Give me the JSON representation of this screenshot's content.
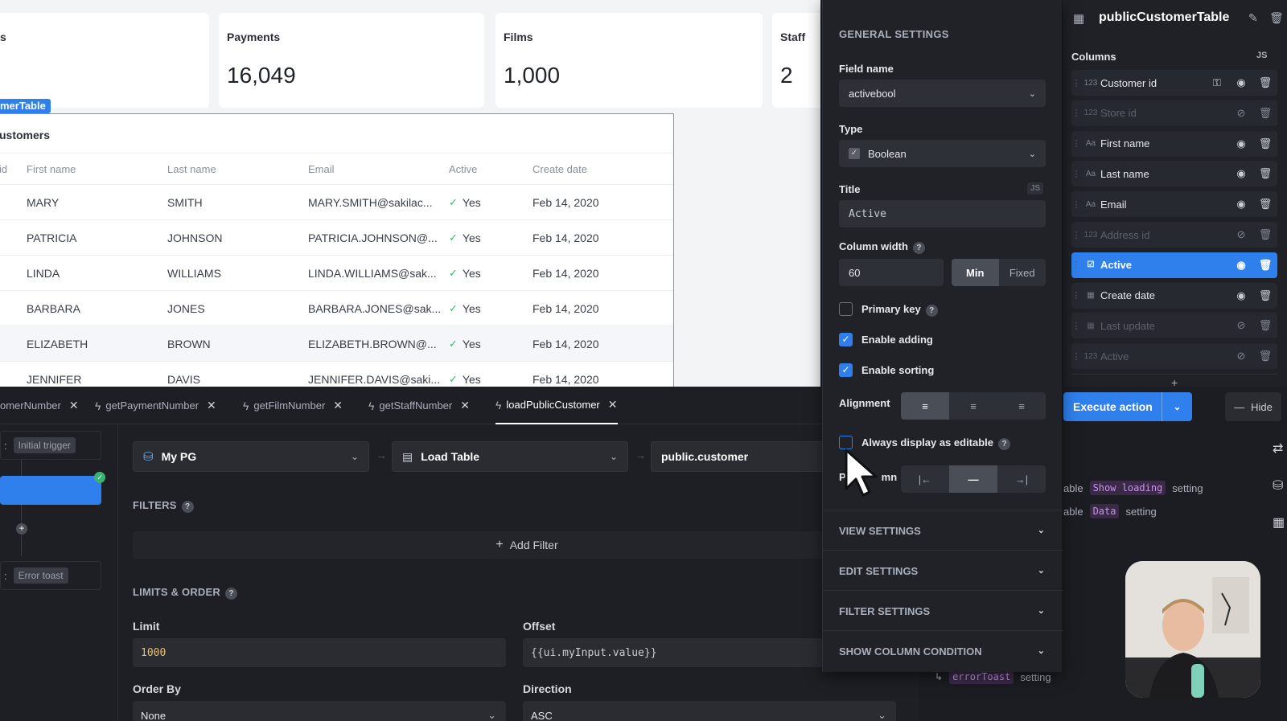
{
  "stats": [
    {
      "label": "s",
      "value": ""
    },
    {
      "label": "Payments",
      "value": "16,049"
    },
    {
      "label": "Films",
      "value": "1,000"
    },
    {
      "label": "Staff",
      "value": "2"
    }
  ],
  "table": {
    "tag": "merTable",
    "heading": "ustomers",
    "columns": [
      "id",
      "First name",
      "Last name",
      "Email",
      "Active",
      "Create date"
    ],
    "rows": [
      [
        "MARY",
        "SMITH",
        "MARY.SMITH@sakilac...",
        "Yes",
        "Feb 14, 2020"
      ],
      [
        "PATRICIA",
        "JOHNSON",
        "PATRICIA.JOHNSON@...",
        "Yes",
        "Feb 14, 2020"
      ],
      [
        "LINDA",
        "WILLIAMS",
        "LINDA.WILLIAMS@sak...",
        "Yes",
        "Feb 14, 2020"
      ],
      [
        "BARBARA",
        "JONES",
        "BARBARA.JONES@sak...",
        "Yes",
        "Feb 14, 2020"
      ],
      [
        "ELIZABETH",
        "BROWN",
        "ELIZABETH.BROWN@...",
        "Yes",
        "Feb 14, 2020"
      ],
      [
        "JENNIFER",
        "DAVIS",
        "JENNIFER.DAVIS@saki...",
        "Yes",
        "Feb 14, 2020"
      ]
    ]
  },
  "query_tabs": [
    {
      "label": "omerNumber",
      "active": false
    },
    {
      "label": "getPaymentNumber",
      "active": false
    },
    {
      "label": "getFilmNumber",
      "active": false
    },
    {
      "label": "getStaffNumber",
      "active": false
    },
    {
      "label": "loadPublicCustomer",
      "active": true
    }
  ],
  "flow": {
    "trigger_prefix": ":",
    "trigger": "Initial trigger",
    "error_prefix": ":",
    "error": "Error toast"
  },
  "query": {
    "resource": "My PG",
    "action": "Load Table",
    "table": "public.customer",
    "filters_label": "FILTERS",
    "add_filter": "Add Filter",
    "limits_label": "LIMITS & ORDER",
    "limit_label": "Limit",
    "limit_value": "1000",
    "offset_label": "Offset",
    "offset_value": "{{ui.myInput.value}}",
    "order_by_label": "Order By",
    "order_by_value": "None",
    "direction_label": "Direction",
    "direction_value": "ASC"
  },
  "settings": {
    "general": "GENERAL SETTINGS",
    "field_name_label": "Field name",
    "field_name": "activebool",
    "type_label": "Type",
    "type": "Boolean",
    "title_label": "Title",
    "title_js": "JS",
    "title": "Active",
    "width_label": "Column width",
    "width": "60",
    "width_min": "Min",
    "width_fixed": "Fixed",
    "primary_key": "Primary key",
    "enable_adding": "Enable adding",
    "enable_sorting": "Enable sorting",
    "alignment": "Alignment",
    "always_editable": "Always display as editable",
    "pin_prefix": "P",
    "pin_suffix": "mn",
    "sections": [
      "VIEW SETTINGS",
      "EDIT SETTINGS",
      "FILTER SETTINGS",
      "SHOW COLUMN CONDITION"
    ]
  },
  "inspector": {
    "title": "publicCustomerTable",
    "columns_label": "Columns",
    "columns_js": "JS",
    "columns": [
      {
        "name": "Customer id",
        "icon": "123",
        "hidden": false,
        "selected": false,
        "key": true
      },
      {
        "name": "Store id",
        "icon": "123",
        "hidden": true,
        "selected": false,
        "key": false
      },
      {
        "name": "First name",
        "icon": "Aa",
        "hidden": false,
        "selected": false,
        "key": false
      },
      {
        "name": "Last name",
        "icon": "Aa",
        "hidden": false,
        "selected": false,
        "key": false
      },
      {
        "name": "Email",
        "icon": "Aa",
        "hidden": false,
        "selected": false,
        "key": false
      },
      {
        "name": "Address id",
        "icon": "123",
        "hidden": true,
        "selected": false,
        "key": false
      },
      {
        "name": "Active",
        "icon": "☑",
        "hidden": false,
        "selected": true,
        "key": false
      },
      {
        "name": "Create date",
        "icon": "▦",
        "hidden": false,
        "selected": false,
        "key": false
      },
      {
        "name": "Last update",
        "icon": "▦",
        "hidden": true,
        "selected": false,
        "key": false
      },
      {
        "name": "Active",
        "icon": "123",
        "hidden": true,
        "selected": false,
        "key": false
      }
    ],
    "execute": "Execute action",
    "hide": "Hide",
    "event1_prefix": "able",
    "event1_code": "Show loading",
    "event1_suffix": "setting",
    "event2_prefix": "able",
    "event2_code": "Data",
    "event2_suffix": "setting",
    "event3_code": "errorToast",
    "event3_suffix": "setting"
  }
}
